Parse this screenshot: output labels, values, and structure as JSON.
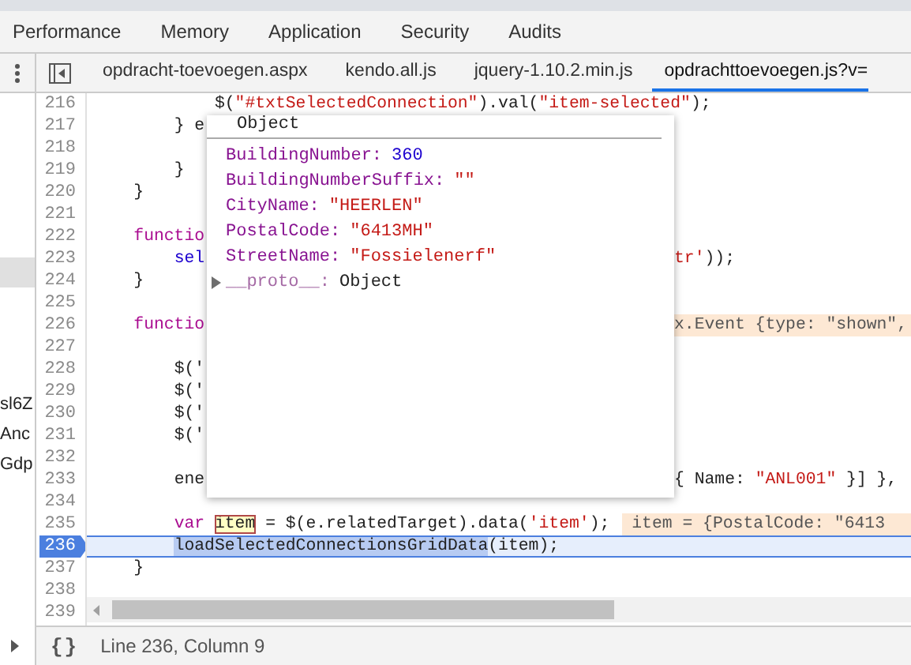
{
  "top_tabs": [
    {
      "label": "Performance",
      "selected": false
    },
    {
      "label": "Memory",
      "selected": false
    },
    {
      "label": "Application",
      "selected": false
    },
    {
      "label": "Security",
      "selected": false
    },
    {
      "label": "Audits",
      "selected": false
    }
  ],
  "navigator": {
    "items": [
      {
        "selected": true
      },
      {
        "label": "sl6Z",
        "selected": false
      },
      {
        "label": "Anc",
        "selected": false
      },
      {
        "label": "Gdp",
        "selected": false
      }
    ]
  },
  "file_tabs": [
    {
      "label": "opdracht-toevoegen.aspx",
      "selected": false
    },
    {
      "label": "kendo.all.js",
      "selected": false
    },
    {
      "label": "jquery-1.10.2.min.js",
      "selected": false
    },
    {
      "label": "opdrachttoevoegen.js?v=",
      "selected": true
    }
  ],
  "editor": {
    "lines": [
      {
        "number": "216",
        "current": false,
        "code": [
          {
            "text": "            $(",
            "kind": "plain"
          },
          {
            "text": "\"#txtSelectedConnection\"",
            "kind": "string"
          },
          {
            "text": ").val(",
            "kind": "plain"
          },
          {
            "text": "\"item-selected\"",
            "kind": "string"
          },
          {
            "text": ");",
            "kind": "plain"
          }
        ]
      },
      {
        "number": "217",
        "current": false,
        "code": [
          {
            "text": "        } e",
            "kind": "plain"
          }
        ]
      },
      {
        "number": "218",
        "current": false
      },
      {
        "number": "219",
        "current": false,
        "code": [
          {
            "text": "        }",
            "kind": "plain"
          }
        ]
      },
      {
        "number": "220",
        "current": false,
        "code": [
          {
            "text": "    }",
            "kind": "plain"
          }
        ]
      },
      {
        "number": "221",
        "current": false
      },
      {
        "number": "222",
        "current": false,
        "code": [
          {
            "text": "    functio",
            "kind": "keyword"
          }
        ]
      },
      {
        "number": "223",
        "current": false,
        "code": [
          {
            "text": "        sel",
            "kind": "variable"
          }
        ],
        "tail": [
          {
            "text": "tr'",
            "kind": "string"
          },
          {
            "text": "));",
            "kind": "plain"
          }
        ]
      },
      {
        "number": "224",
        "current": false,
        "code": [
          {
            "text": "    }",
            "kind": "plain"
          }
        ]
      },
      {
        "number": "225",
        "current": false
      },
      {
        "number": "226",
        "current": false,
        "code": [
          {
            "text": "    functio",
            "kind": "keyword"
          }
        ],
        "tail": [
          {
            "text": "x.Event {type: \"shown\",",
            "kind": "value"
          }
        ]
      },
      {
        "number": "227",
        "current": false
      },
      {
        "number": "228",
        "current": false,
        "code": [
          {
            "text": "        $('",
            "kind": "plain"
          }
        ]
      },
      {
        "number": "229",
        "current": false,
        "code": [
          {
            "text": "        $('",
            "kind": "plain"
          }
        ]
      },
      {
        "number": "230",
        "current": false,
        "code": [
          {
            "text": "        $('",
            "kind": "plain"
          }
        ]
      },
      {
        "number": "231",
        "current": false,
        "code": [
          {
            "text": "        $('",
            "kind": "plain"
          }
        ]
      },
      {
        "number": "232",
        "current": false
      },
      {
        "number": "233",
        "current": false,
        "code": [
          {
            "text": "        ene",
            "kind": "plain"
          }
        ],
        "tail": [
          {
            "text": "{ Name: ",
            "kind": "plain"
          },
          {
            "text": "\"ANL001\"",
            "kind": "string"
          },
          {
            "text": " }] },",
            "kind": "plain"
          }
        ]
      },
      {
        "number": "234",
        "current": false
      },
      {
        "number": "235",
        "current": false,
        "code": [
          {
            "text": "        var",
            "kind": "keyword"
          },
          {
            "text": " item",
            "kind": "hover"
          },
          {
            "text": " = $(e.relatedTarget).data(",
            "kind": "plain"
          },
          {
            "text": "'item'",
            "kind": "string"
          },
          {
            "text": ");",
            "kind": "plain"
          },
          {
            "text": "item = {PostalCode: \"6413",
            "kind": "value"
          }
        ]
      },
      {
        "number": "236",
        "current": true,
        "code": [
          {
            "text": "        loadSelectedConnectionsGridData",
            "kind": "selection"
          },
          {
            "text": "(item);",
            "kind": "plain"
          }
        ]
      },
      {
        "number": "237",
        "current": false,
        "code": [
          {
            "text": "    }",
            "kind": "plain"
          }
        ]
      },
      {
        "number": "238",
        "current": false
      },
      {
        "number": "239",
        "current": false
      }
    ],
    "popover": {
      "title": "Object",
      "properties": [
        {
          "key": "BuildingNumber:",
          "value": "360",
          "kind": "number"
        },
        {
          "key": "BuildingNumberSuffix:",
          "value": "\"\"",
          "kind": "string"
        },
        {
          "key": "CityName:",
          "value": "\"HEERLEN\"",
          "kind": "string"
        },
        {
          "key": "PostalCode:",
          "value": "\"6413MH\"",
          "kind": "string"
        },
        {
          "key": "StreetName:",
          "value": "\"Fossielenerf\"",
          "kind": "string"
        },
        {
          "key": "__proto__:",
          "value": "Object",
          "kind": "object",
          "expanded": false
        }
      ]
    }
  },
  "status_bar": {
    "format_button": "{}",
    "cursor_position": "Line 236, Column 9"
  }
}
